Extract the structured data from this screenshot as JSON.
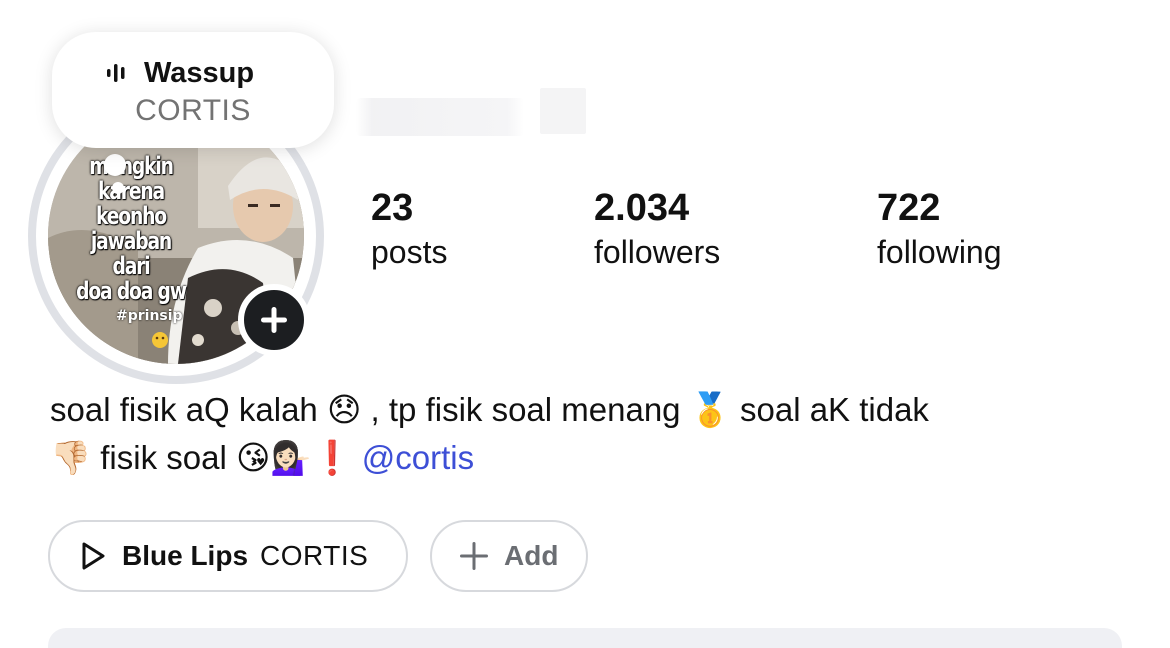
{
  "note": {
    "song_title": "Wassup",
    "artist": "CORTIS",
    "icon": "audio-wave-icon"
  },
  "avatar": {
    "caption": "mungkin\nkarena\nkeonho\njawaban dari\ndoa doa gw",
    "hashtag": "#prinsip",
    "add_story_icon": "plus-icon"
  },
  "stats": [
    {
      "value": "23",
      "label": "posts"
    },
    {
      "value": "2.034",
      "label": "followers"
    },
    {
      "value": "722",
      "label": "following"
    }
  ],
  "bio": {
    "part1": "soal fisik aQ kalah",
    "emoji1": "😞",
    "part2": ", tp fisik soal menang",
    "emoji2": "🥇",
    "part3": "soal aK tidak",
    "emoji3": "👎🏻",
    "part4": "fisik soal",
    "emoji4": "😘💁🏻‍♀️❗",
    "mention": "@cortis"
  },
  "profile_music": {
    "icon": "play-icon",
    "title": "Blue Lips",
    "artist": "CORTIS"
  },
  "add_button": {
    "icon": "plus-icon",
    "label": "Add"
  },
  "colors": {
    "mention": "#3d4fd6",
    "ring": "#dfe1e6",
    "add_story_bg": "#1c1e21"
  }
}
